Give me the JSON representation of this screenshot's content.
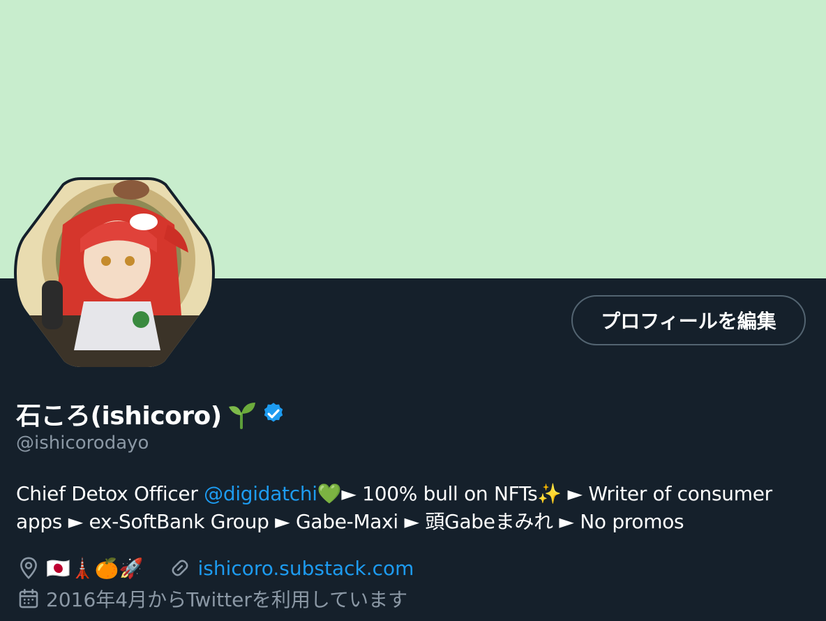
{
  "profile": {
    "display_name": "石ころ(ishicoro)",
    "handle": "@ishicorodayo",
    "edit_button_label": "プロフィールを編集",
    "name_emoji": "seedling-emoji",
    "verified": "verified-badge-icon"
  },
  "bio": {
    "text_1": "Chief Detox Officer ",
    "mention": "@digidatchi",
    "text_2": "💚► 100% bull on NFTs✨ ► Writer of consumer apps ► ex-SoftBank Group ► Gabe-Maxi ► 頭Gabeまみれ ► No promos"
  },
  "meta": {
    "location_emojis": "🇯🇵🗼🍊🚀",
    "website": "ishicoro.substack.com",
    "joined": "2016年4月からTwitterを利用しています"
  },
  "icons": {
    "location": "map-pin-icon",
    "link": "link-icon",
    "calendar": "calendar-icon"
  },
  "colors": {
    "banner": "#c8edcd",
    "background": "#15202b",
    "accent": "#1d9bf0",
    "secondary_text": "#8b98a5"
  }
}
